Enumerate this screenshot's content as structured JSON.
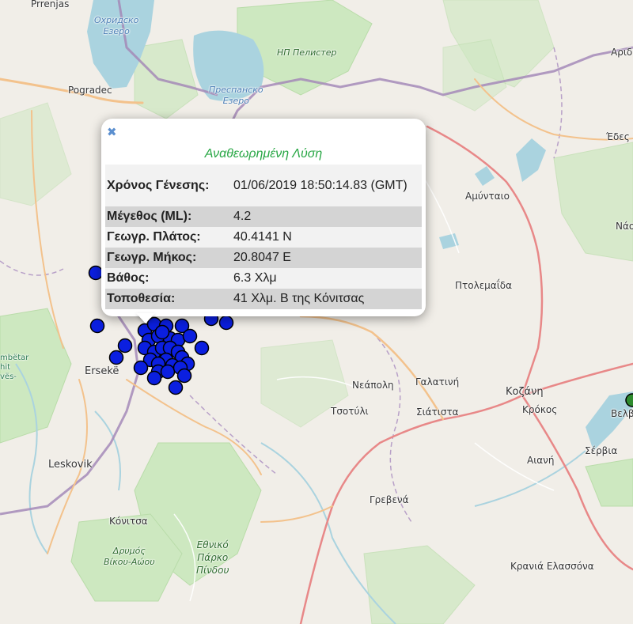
{
  "map": {
    "places": [
      {
        "id": "prrenjas",
        "text": "Prrenjas"
      },
      {
        "id": "ohrid-lake",
        "text": "Охридско\nЕзеро"
      },
      {
        "id": "np-pelister",
        "text": "НП Пелистер"
      },
      {
        "id": "pogradec",
        "text": "Pogradec"
      },
      {
        "id": "prespa-lake",
        "text": "Преспанско\nЕзеро"
      },
      {
        "id": "arid",
        "text": "Αριδ"
      },
      {
        "id": "edes",
        "text": "Έδες"
      },
      {
        "id": "amyntaio",
        "text": "Αμύνταιο"
      },
      {
        "id": "naou",
        "text": "Νάο"
      },
      {
        "id": "ptolemaida",
        "text": "Πτολεμαΐδα"
      },
      {
        "id": "mbetar",
        "text": "mbëtar\nhit\nvës-"
      },
      {
        "id": "erseke",
        "text": "Ersekë"
      },
      {
        "id": "neapoli",
        "text": "Νεάπολη"
      },
      {
        "id": "galatini",
        "text": "Γαλατινή"
      },
      {
        "id": "kozani",
        "text": "Κοζάνη"
      },
      {
        "id": "tsotyli",
        "text": "Τσοτύλι"
      },
      {
        "id": "siatista",
        "text": "Σιάτιστα"
      },
      {
        "id": "krokos",
        "text": "Κρόκος"
      },
      {
        "id": "velvento",
        "text": "Βελβ"
      },
      {
        "id": "leskovik",
        "text": "Leskovik"
      },
      {
        "id": "aiani",
        "text": "Αιανή"
      },
      {
        "id": "servia",
        "text": "Σέρβια"
      },
      {
        "id": "grevena",
        "text": "Γρεβενά"
      },
      {
        "id": "konitsa",
        "text": "Κόνιτσα"
      },
      {
        "id": "drymos",
        "text": "Δρυμός\nΒίκου-Αώου"
      },
      {
        "id": "pindos",
        "text": "Εθνικό\nΠάρκο\nΠίνδου"
      },
      {
        "id": "kranea",
        "text": "Κρανιά Ελασσόνα"
      }
    ]
  },
  "colors": {
    "marker_blue": "#0b1fe0",
    "marker_green": "#2e8b2e",
    "popup_title": "#28a745",
    "row_light": "#f2f2f2",
    "row_dark": "#d4d4d4"
  },
  "popup": {
    "close_icon": "close-icon",
    "close_symbol": "✖",
    "title": "Αναθεωρημένη Λύση",
    "rows": [
      {
        "label": "Χρόνος Γένεσης:",
        "value": "01/06/2019 18:50:14.83 (GMT)"
      },
      {
        "label": "Μέγεθος (ML):",
        "value": "4.2"
      },
      {
        "label": "Γεωγρ. Πλάτος:",
        "value": "40.4141 N"
      },
      {
        "label": "Γεωγρ. Μήκος:",
        "value": "20.8047 E"
      },
      {
        "label": "Βάθος:",
        "value": "6.3 Χλμ"
      },
      {
        "label": "Τοποθεσία:",
        "value": "41 Χλμ. Β της Κόνιτσας"
      }
    ]
  }
}
